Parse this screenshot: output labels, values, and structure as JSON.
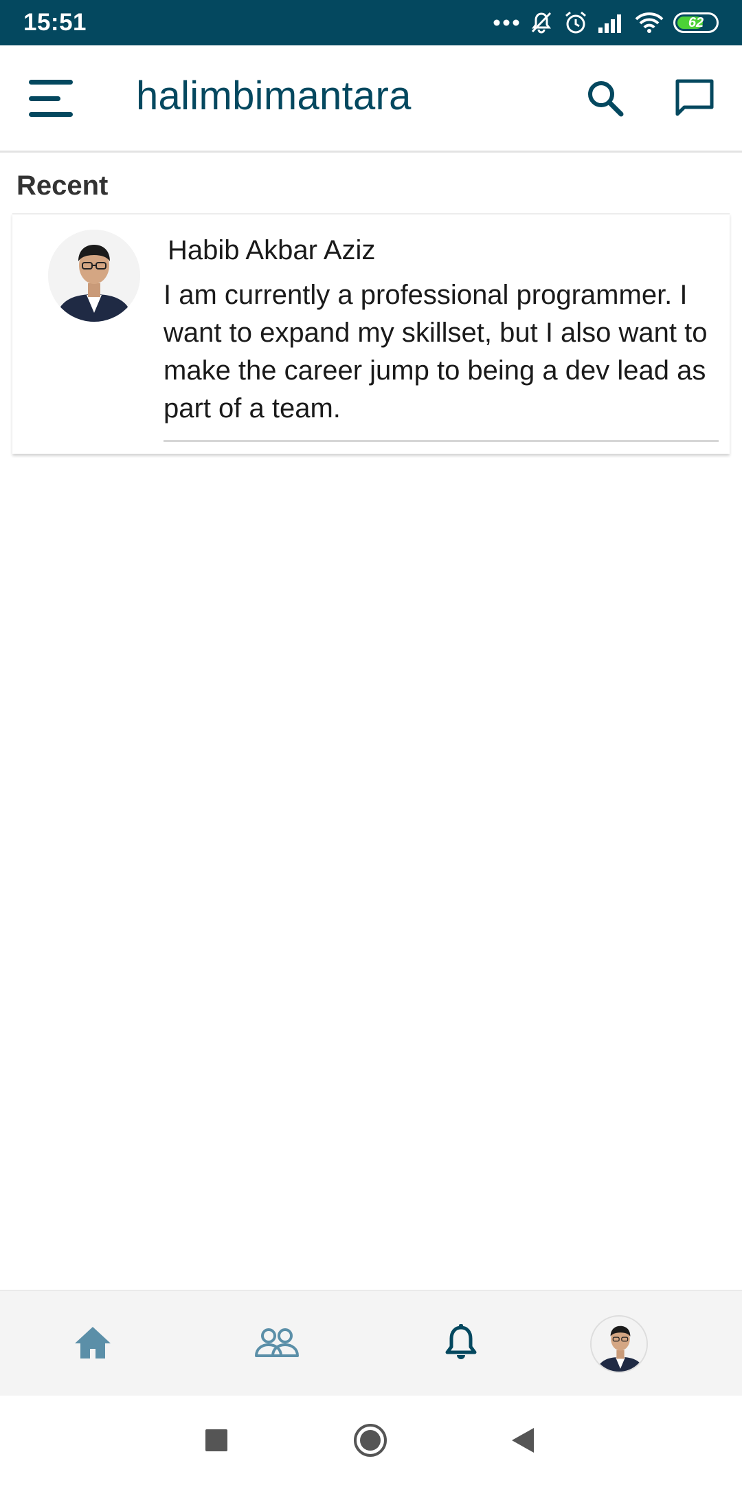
{
  "status_bar": {
    "time": "15:51",
    "battery_level": "62",
    "icons": [
      "more-dots-icon",
      "mute-icon",
      "alarm-icon",
      "signal-icon",
      "wifi-icon",
      "battery-icon"
    ]
  },
  "header": {
    "title": "halimbimantara",
    "menu_icon": "hamburger-menu-icon",
    "search_icon": "search-icon",
    "chat_icon": "chat-icon"
  },
  "notifications": {
    "section_title": "Recent",
    "items": [
      {
        "name": "Habib Akbar Aziz",
        "message": "I am currently a professional programmer. I want to expand my skillset, but I also want to make the career jump to being a dev lead as part of a team."
      }
    ]
  },
  "bottom_nav": {
    "items": [
      {
        "icon": "home-icon",
        "active": false
      },
      {
        "icon": "people-icon",
        "active": false
      },
      {
        "icon": "bell-icon",
        "active": true
      },
      {
        "icon": "profile-avatar",
        "active": false
      }
    ]
  },
  "system_nav": {
    "items": [
      "recents-square-icon",
      "home-circle-icon",
      "back-triangle-icon"
    ]
  },
  "colors": {
    "primary": "#04485f",
    "nav_inactive": "#5b8fa8",
    "battery": "#4cd137"
  }
}
